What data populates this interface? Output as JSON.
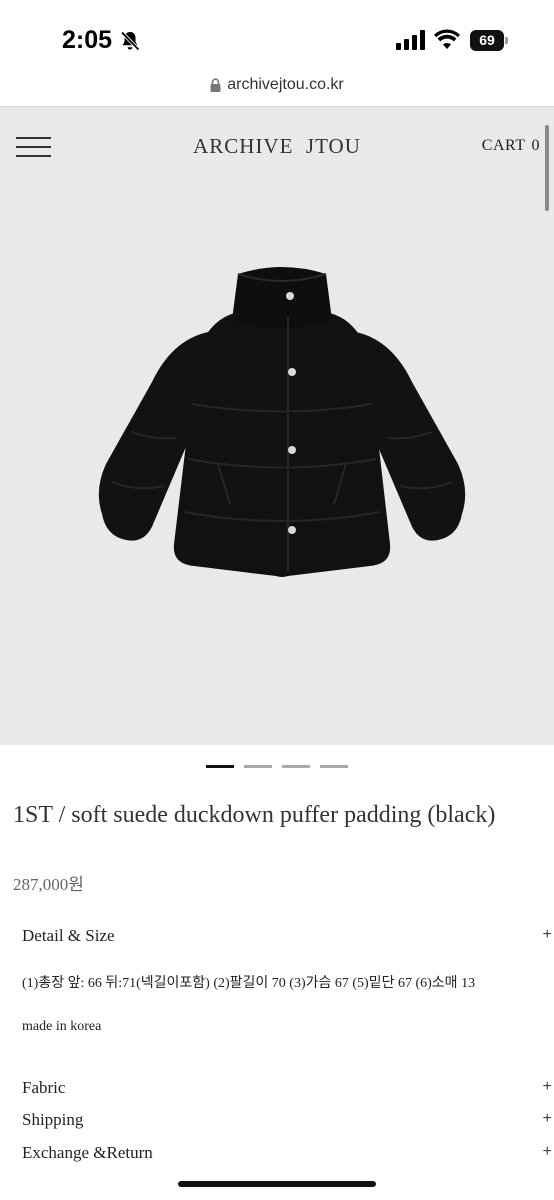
{
  "status_bar": {
    "time": "2:05",
    "battery": "69",
    "icons": [
      "bell-slash-icon",
      "signal-icon",
      "wifi-icon",
      "battery-icon"
    ]
  },
  "browser": {
    "url": "archivejtou.co.kr"
  },
  "header": {
    "logo": "ARCHIVE  JTOU",
    "cart_label": "CART",
    "cart_count": "0"
  },
  "carousel": {
    "count": 4,
    "active_index": 0
  },
  "product": {
    "title": "1ST / soft suede duckdown puffer padding (black)",
    "price": "287,000원",
    "image": "black-puffer-jacket"
  },
  "sections": {
    "detail": {
      "label": "Detail & Size",
      "toggle": "+"
    },
    "measurements": "(1)총장 앞: 66 뒤:71(넥길이포함) (2)팔길이 70 (3)가슴 67 (5)밑단 67 (6)소매 13",
    "origin": "made in korea",
    "fabric": {
      "label": "Fabric",
      "toggle": "+"
    },
    "shipping": {
      "label": "Shipping",
      "toggle": "+"
    },
    "exchange": {
      "label": "Exchange &Return",
      "toggle": "+"
    }
  },
  "colors": {
    "hero_background": "#e9e9eb",
    "text": "#222222",
    "price": "#666666"
  }
}
